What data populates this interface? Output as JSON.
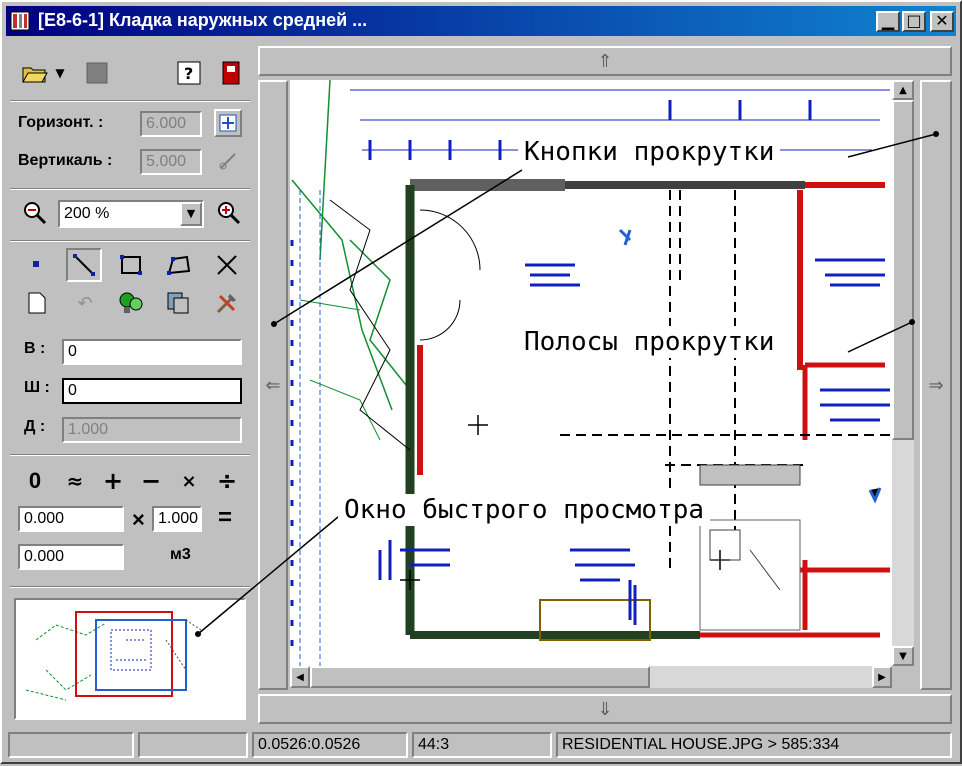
{
  "window": {
    "title": "[E8-6-1] Кладка наружных средней ..."
  },
  "panel": {
    "horizontal_label": "Горизонт. :",
    "horizontal_value": "6.000",
    "vertical_label": "Вертикаль :",
    "vertical_value": "5.000",
    "zoom_value": "200 %",
    "field_b_label": "В :",
    "field_b_value": "0",
    "field_w_label": "Ш :",
    "field_w_value": "0",
    "field_d_label": "Д :",
    "field_d_value": "1.000",
    "calc_ops": [
      "0",
      "≈",
      "+",
      "−",
      "×",
      "÷"
    ],
    "calc_value1": "0.000",
    "calc_mult": "×",
    "calc_factor": "1.000",
    "calc_eq": "=",
    "calc_result": "0.000",
    "calc_unit": "м3"
  },
  "callouts": {
    "scroll_buttons": "Кнопки прокрутки",
    "scrollbars": "Полосы прокрутки",
    "quick_view": "Окно быстрого просмотра"
  },
  "status": {
    "scale": "0.0526:0.0526",
    "ratio": "44:3",
    "file": "RESIDENTIAL HOUSE.JPG > 585:334"
  },
  "colors": {
    "title_start": "#000080",
    "title_end": "#1084d0",
    "wall_red": "#d01010",
    "plan_blue": "#1020c0",
    "plan_green": "#109030"
  }
}
